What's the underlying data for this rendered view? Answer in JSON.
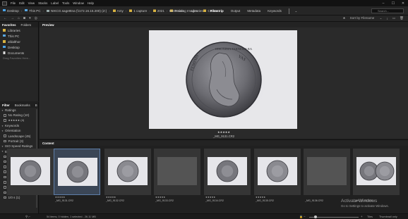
{
  "menubar": {
    "items": [
      "File",
      "Edit",
      "View",
      "Stacks",
      "Label",
      "Tools",
      "Window",
      "Help"
    ],
    "controls": [
      "–",
      "☐",
      "✕"
    ]
  },
  "path": {
    "crumbs": [
      "Desktop",
      "This PC",
      "NIKCG.sage8tna (\\\\172.16.16.200) (Z:)",
      "Amy",
      "1 capture",
      "2021",
      "Training Images",
      "Canon"
    ]
  },
  "workspaces": {
    "items": [
      "Essentials",
      "Libraries",
      "Filmstrip",
      "Output",
      "Metadata",
      "Keywords"
    ],
    "active": "Filmstrip",
    "search_placeholder": "Search..."
  },
  "toolbar": {
    "sort_label": "Sort by Filename"
  },
  "favorites": {
    "tabs": [
      "Favorites",
      "Folders"
    ],
    "items": [
      "Libraries",
      "This PC",
      "afdalthor",
      "Desktop",
      "Documents"
    ],
    "hint": "Drag Favorites Here..."
  },
  "filter": {
    "tabs": [
      "Filter",
      "Bookmarks",
      "B",
      "Col"
    ],
    "sections": [
      {
        "label": "Ratings",
        "type": "header"
      },
      {
        "label": "No Rating (10)",
        "type": "item"
      },
      {
        "label": "★★★★★ (4)",
        "type": "item"
      },
      {
        "label": "Keywords",
        "type": "header"
      },
      {
        "label": "Orientation",
        "type": "header"
      },
      {
        "label": "Landscape (45)",
        "type": "item"
      },
      {
        "label": "Portrait (3)",
        "type": "item"
      },
      {
        "label": "ISO Speed Ratings",
        "type": "header"
      },
      {
        "label": "Exposure Time",
        "type": "header"
      },
      {
        "label": "1/10 s (1)",
        "type": "item"
      },
      {
        "label": "1/13 s (1)",
        "type": "item"
      },
      {
        "label": "1/25 s (1)",
        "type": "item"
      },
      {
        "label": "1/50 s (1)",
        "type": "item"
      },
      {
        "label": "1/40 s (5)",
        "type": "item"
      },
      {
        "label": "1/50 s (5)",
        "type": "item"
      },
      {
        "label": "1/60 s (2)",
        "type": "item"
      },
      {
        "label": "1/80 s (3)",
        "type": "item"
      },
      {
        "label": "1/0 s (1)",
        "type": "item"
      }
    ]
  },
  "preview": {
    "tab": "Preview",
    "stars": "★★★★★",
    "filename": "_MG_9131.CR2",
    "coin_inscriptions": [
      "FEMINIS",
      "VAS",
      "IERONIMA FARNESIA RA"
    ]
  },
  "content": {
    "tab": "Content",
    "thumbnails": [
      {
        "stars": "",
        "name": "",
        "image": "coin",
        "partial": true
      },
      {
        "stars": "★★★★★",
        "name": "_MG_9131.CR2",
        "image": "coin",
        "selected": true
      },
      {
        "stars": "★★★★★",
        "name": "_MG_9132.CR2",
        "image": "coin-reverse"
      },
      {
        "stars": "★★★★★",
        "name": "_MG_9133.CR2",
        "image": "grey"
      },
      {
        "stars": "★★★★★",
        "name": "_MG_9134.CR2",
        "image": "coin"
      },
      {
        "stars": "★★★★★",
        "name": "_MG_9135.CR2",
        "image": "coin-reverse"
      },
      {
        "stars": "",
        "name": "_MG_9136.CR2",
        "image": "grey"
      },
      {
        "stars": "",
        "name": "_MG_9137.CR2",
        "image": "coin-pair"
      }
    ]
  },
  "status": {
    "text": "54 items, 0 hidden, 1 selected - 26.11 MB",
    "tiles": "Tiles",
    "thumbnail_only": "Thumbnail only"
  },
  "watermark": {
    "title": "Activate Windows",
    "subtitle": "Go to Settings to activate Windows."
  },
  "colors": {
    "background": "#1e1e1e",
    "selection": "#5e7ea8",
    "folder": "#d8b341"
  }
}
